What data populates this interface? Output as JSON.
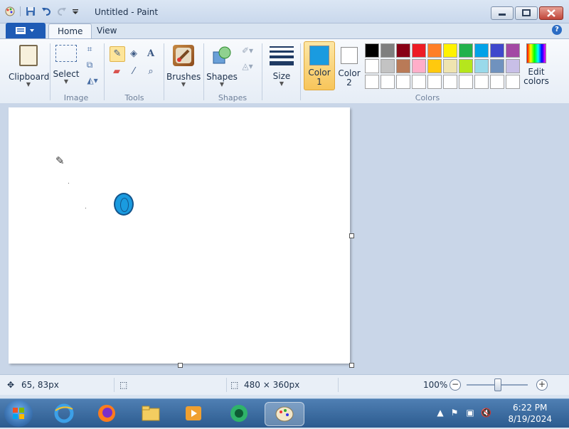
{
  "window": {
    "title": "Untitled - Paint"
  },
  "tabs": [
    {
      "label": "Home"
    },
    {
      "label": "View"
    }
  ],
  "ribbon": {
    "clipboard": {
      "label": "Clipboard"
    },
    "image": {
      "select_label": "Select",
      "group_label": "Image"
    },
    "tools": {
      "group_label": "Tools"
    },
    "brushes": {
      "label": "Brushes"
    },
    "shapes": {
      "label": "Shapes",
      "group_label": "Shapes"
    },
    "size": {
      "label": "Size"
    },
    "color1": {
      "label_line1": "Color",
      "label_line2": "1",
      "color": "#1a9be0"
    },
    "color2": {
      "label_line1": "Color",
      "label_line2": "2",
      "color": "#ffffff"
    },
    "colors_group_label": "Colors",
    "edit_colors": {
      "line1": "Edit",
      "line2": "colors"
    },
    "palette_row1": [
      "#000000",
      "#7f7f7f",
      "#880015",
      "#ed1c24",
      "#ff7f27",
      "#fff200",
      "#22b14c",
      "#00a2e8",
      "#3f48cc",
      "#a349a4"
    ],
    "palette_row2": [
      "#ffffff",
      "#c3c3c3",
      "#b97a57",
      "#ffaec9",
      "#ffc90e",
      "#efe4b0",
      "#b5e61d",
      "#99d9ea",
      "#7092be",
      "#c8bfe7"
    ],
    "palette_row3": [
      "#ffffff",
      "#ffffff",
      "#ffffff",
      "#ffffff",
      "#ffffff",
      "#ffffff",
      "#ffffff",
      "#ffffff",
      "#ffffff",
      "#ffffff"
    ]
  },
  "statusbar": {
    "cursor_pos": "65, 83px",
    "image_size": "480 × 360px",
    "zoom": "100%"
  },
  "taskbar": {
    "time": "6:22 PM",
    "date": "8/19/2024"
  }
}
